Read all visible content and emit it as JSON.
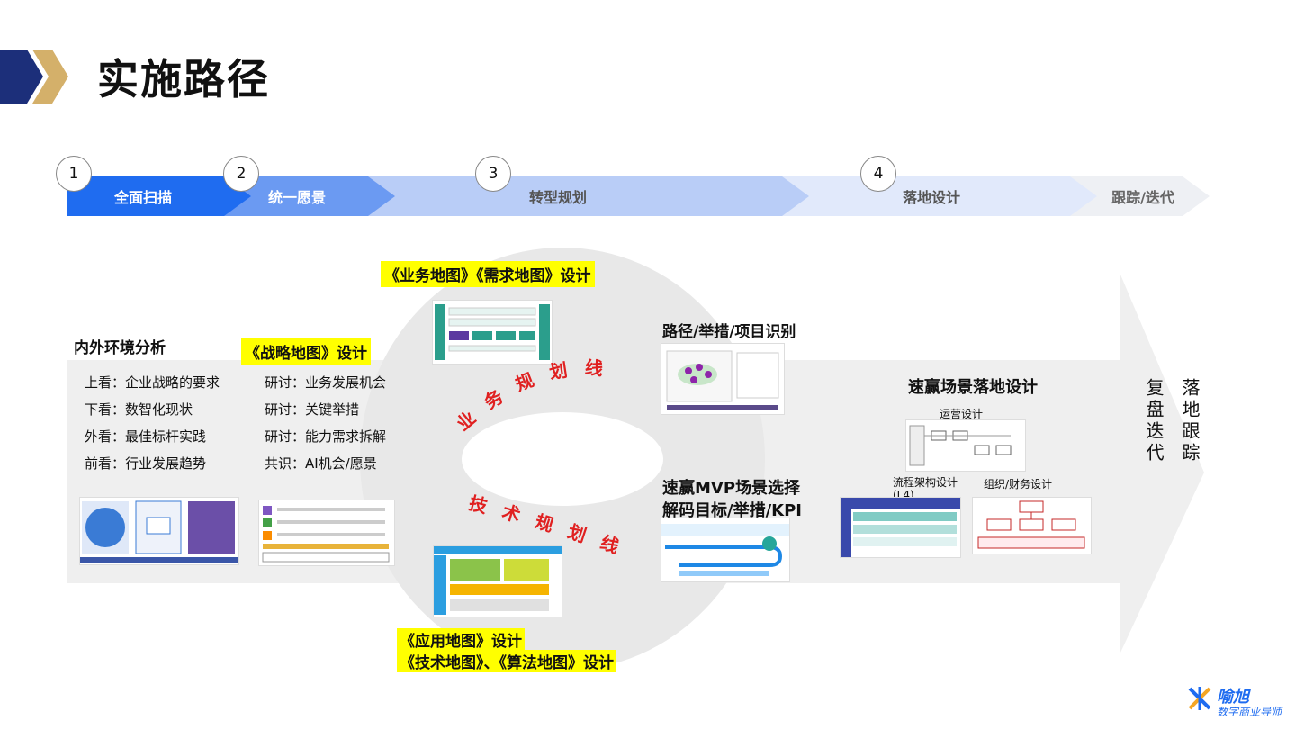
{
  "title": "实施路径",
  "phases": [
    {
      "num": "1",
      "label": "全面扫描"
    },
    {
      "num": "2",
      "label": "统一愿景"
    },
    {
      "num": "3",
      "label": "转型规划"
    },
    {
      "num": "4",
      "label": "落地设计"
    },
    {
      "num": "",
      "label": "跟踪/迭代"
    }
  ],
  "left": {
    "heading": "内外环境分析",
    "items": [
      "上看：企业战略的要求",
      "下看：数智化现状",
      "外看：最佳标杆实践",
      "前看：行业发展趋势"
    ]
  },
  "strategy": {
    "heading": "《战略地图》设计",
    "items": [
      "研讨：业务发展机会",
      "研讨：关键举措",
      "研讨：能力需求拆解",
      "共识：AI机会/愿景"
    ]
  },
  "business_map": "《业务地图》《需求地图》设计",
  "business_line": "业务规划线",
  "tech_line": "技术规划线",
  "app_map_1": "《应用地图》设计",
  "app_map_2": "《技术地图》、《算法地图》设计",
  "path_title": "路径/举措/项目识别",
  "mvp_1": "速赢MVP场景选择",
  "mvp_2": "解码目标/举措/KPI",
  "quick_win": "速赢场景落地设计",
  "ops_design": "运营设计",
  "process_design": "流程架构设计",
  "process_level": "(L4)",
  "org_design": "组织/财务设计",
  "tracking": "落地跟踪",
  "review": "复盘迭代",
  "logo": {
    "name": "喻旭",
    "tagline": "数字商业导师"
  },
  "colors": {
    "blue": "#1f6cf0",
    "yellow": "#ffff00",
    "red": "#e02020",
    "navy": "#1c2f7a",
    "gold": "#d4b06a"
  }
}
